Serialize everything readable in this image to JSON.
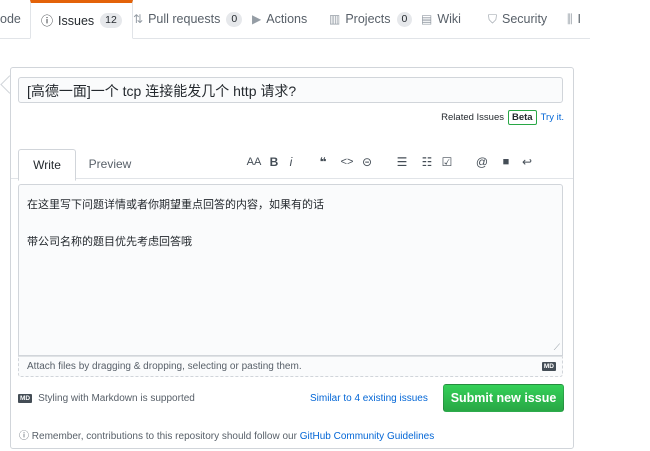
{
  "nav": {
    "code_partial": "ode",
    "issues": {
      "label": "Issues",
      "count": "12"
    },
    "pull_requests": {
      "label": "Pull requests",
      "count": "0"
    },
    "actions": {
      "label": "Actions"
    },
    "projects": {
      "label": "Projects",
      "count": "0"
    },
    "wiki": {
      "label": "Wiki"
    },
    "security": {
      "label": "Security"
    },
    "insights_partial": "I"
  },
  "issue_form": {
    "title_value": "[高德一面]一个 tcp 连接能发几个 http 请求?",
    "related_issues": {
      "label": "Related Issues",
      "badge": "Beta",
      "try_it": "Try it."
    },
    "tabs": {
      "write": "Write",
      "preview": "Preview"
    },
    "toolbar": {
      "heading": "AA",
      "bold": "B",
      "italic": "i",
      "quote": "❝",
      "code": "<>",
      "link": "⊝",
      "unordered_list": "☰",
      "ordered_list": "☷",
      "task_list": "☑",
      "mention": "@",
      "reference": "■",
      "reply": "↩"
    },
    "body_lines": [
      "在这里写下问题详情或者你期望重点回答的内容，如果有的话",
      "带公司名称的题目优先考虑回答哦"
    ],
    "attach_text": "Attach files by dragging & dropping, selecting or pasting them.",
    "md_badge": "MD",
    "markdown_note": "Styling with Markdown is supported",
    "similar_issues": "Similar to 4 existing issues",
    "submit_label": "Submit new issue"
  },
  "remember": {
    "prefix": "Remember, contributions to this repository should follow our",
    "link": "GitHub Community Guidelines"
  }
}
